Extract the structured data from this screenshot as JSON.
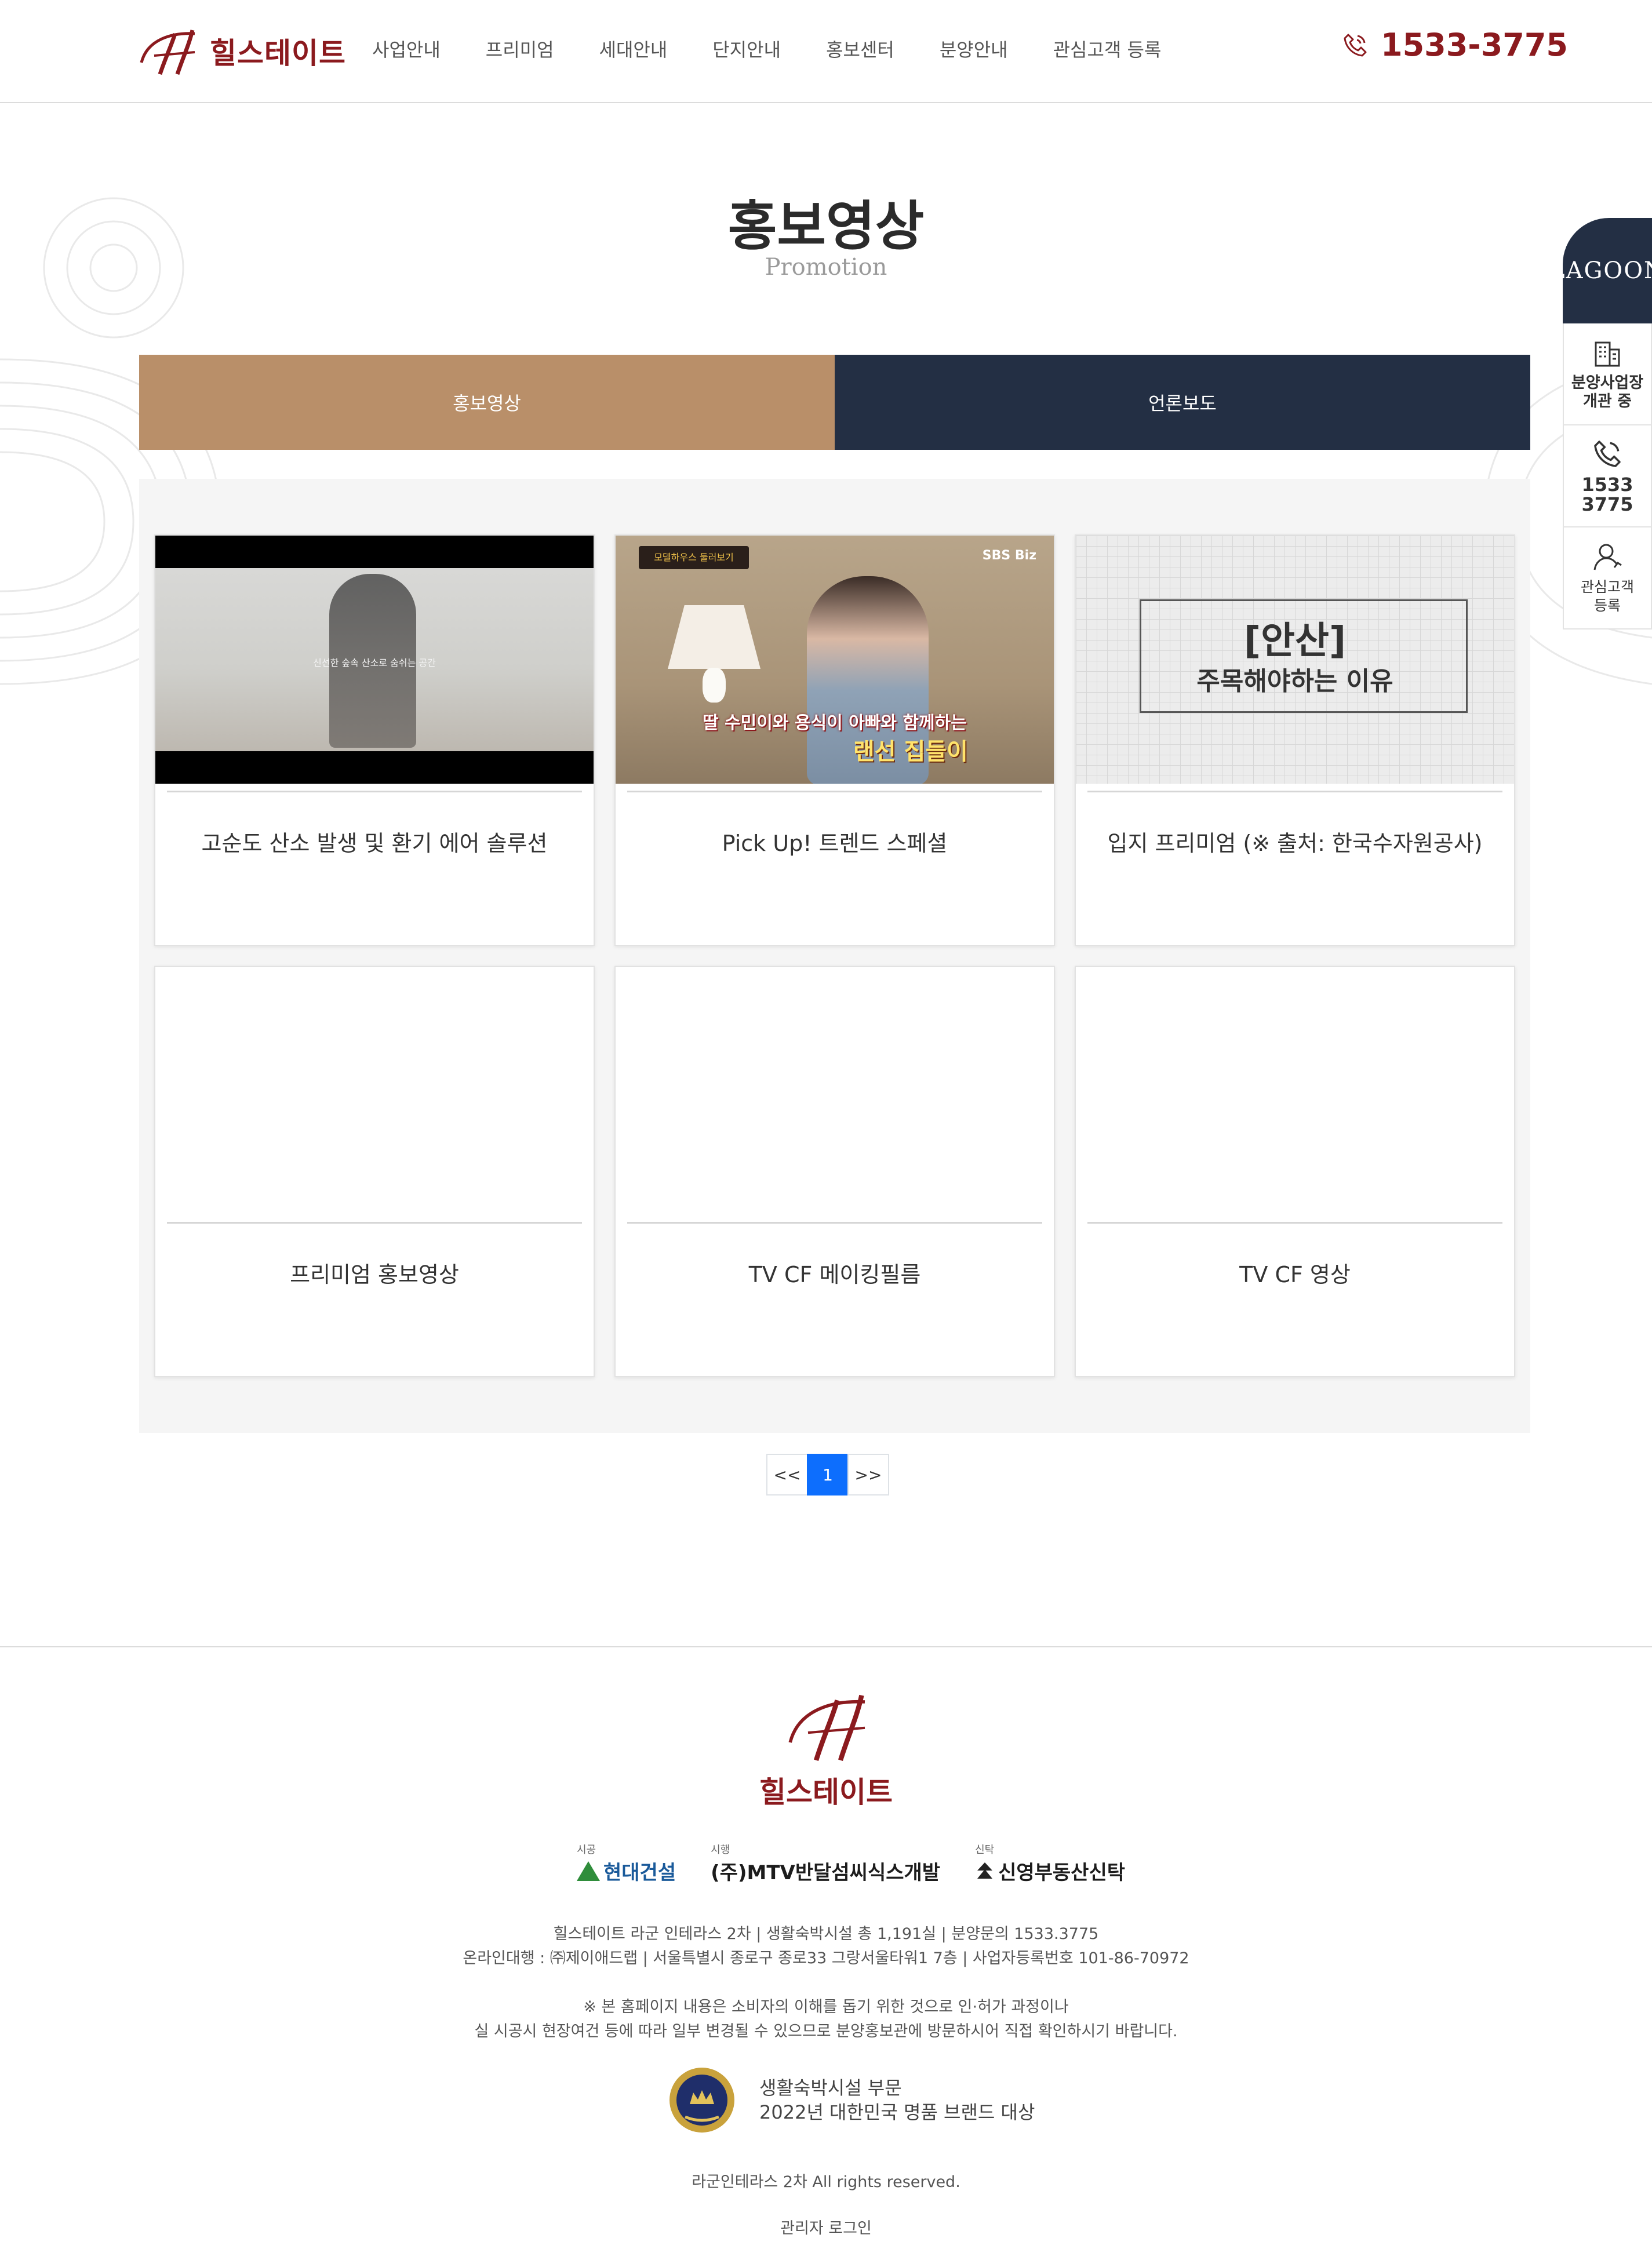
{
  "header": {
    "logo_text": "힐스테이트",
    "nav": [
      "사업안내",
      "프리미엄",
      "세대안내",
      "단지안내",
      "홍보센터",
      "분양안내",
      "관심고객 등록"
    ],
    "phone": "1533-3775"
  },
  "page": {
    "title": "홍보영상",
    "subtitle": "Promotion"
  },
  "tabs": [
    {
      "label": "홍보영상",
      "active": true
    },
    {
      "label": "언론보도",
      "active": false
    }
  ],
  "videos": [
    {
      "title": "고순도 산소 발생 및 환기 에어 솔루션",
      "thumb_caption": "신선한 숲속 산소로 숨쉬는 공간"
    },
    {
      "title": "Pick Up! 트렌드 스페셜",
      "thumb_badge": "모델하우스 둘러보기",
      "thumb_channel": "SBS Biz",
      "thumb_sub1": "딸 수민이와 용식이 아빠와 함께하는",
      "thumb_sub2": "랜선 집들이"
    },
    {
      "title": "입지 프리미엄 (※ 출처: 한국수자원공사)",
      "thumb_big": "[안산]",
      "thumb_small": "주목해야하는 이유"
    },
    {
      "title": "프리미엄 홍보영상"
    },
    {
      "title": "TV CF 메이킹필름"
    },
    {
      "title": "TV CF 영상"
    }
  ],
  "pagination": {
    "prev": "<<",
    "current": "1",
    "next": ">>"
  },
  "float_panel": {
    "top_logo": "LAGOON",
    "items": [
      {
        "label_line1": "분양사업장",
        "label_line2": "개관 중",
        "icon": "building-icon"
      },
      {
        "label_line1": "1533",
        "label_line2": "3775",
        "icon": "phone-icon"
      },
      {
        "label_line1": "관심고객",
        "label_line2": "등록",
        "icon": "user-icon"
      }
    ]
  },
  "footer": {
    "logo_text": "힐스테이트",
    "partners": [
      {
        "role": "시공",
        "name": "현대건설"
      },
      {
        "role": "시행",
        "name": "(주)MTV반달섬씨식스개발"
      },
      {
        "role": "신탁",
        "name": "신영부동산신탁"
      }
    ],
    "info_line1": "힐스테이트 라군 인테라스 2차  |  생활숙박시설 총 1,191실  |  분양문의 1533.3775",
    "info_line2": "온라인대행 : ㈜제이애드랩  |  서울특별시 종로구 종로33 그랑서울타워1 7층  |  사업자등록번호 101-86-70972",
    "notice_line1": "※ 본 홈페이지 내용은 소비자의 이해를 돕기 위한 것으로 인·허가 과정이나",
    "notice_line2": "실 시공시 현장여건 등에 따라 일부 변경될 수 있으므로 분양홍보관에 방문하시어 직접 확인하시기 바랍니다.",
    "award_line1": "생활숙박시설 부문",
    "award_line2": "2022년 대한민국 명품 브랜드 대상",
    "copyright": "라군인테라스 2차 All rights reserved.",
    "admin_login": "관리자 로그인"
  },
  "colors": {
    "brand": "#8b1a1e",
    "tab_active": "#b98f69",
    "tab_inactive": "#232f44",
    "pagination_active": "#0d6efd"
  }
}
